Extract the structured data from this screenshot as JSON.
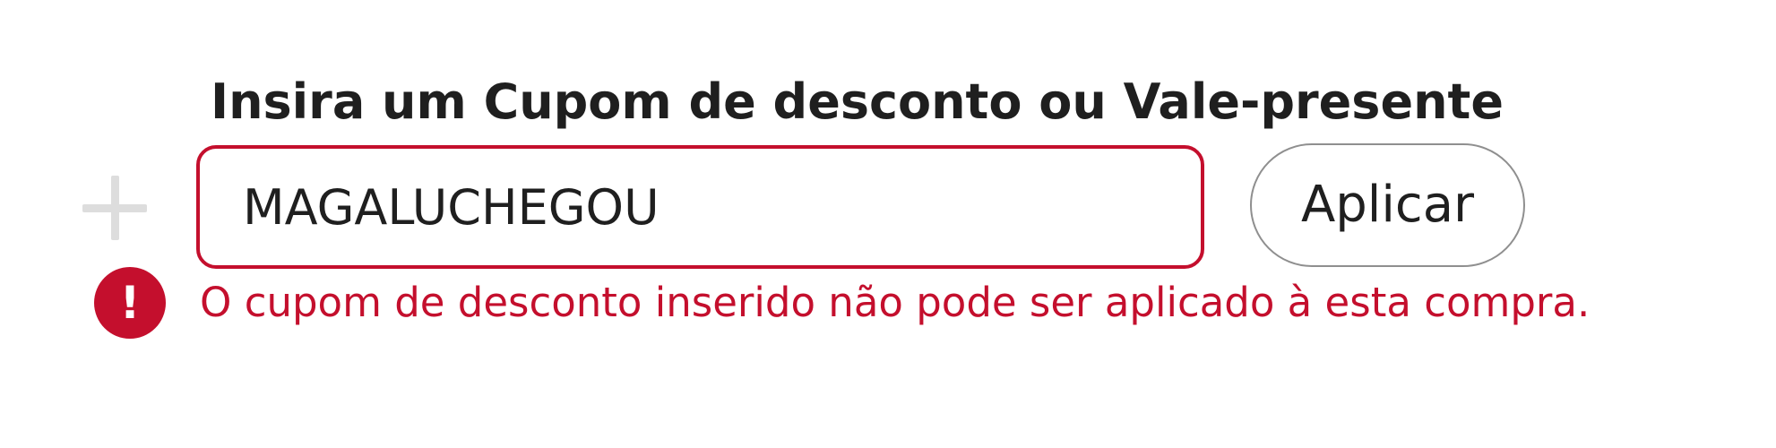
{
  "coupon_form": {
    "label": "Insira um Cupom de desconto ou Vale-presente",
    "expand_icon": "plus-icon",
    "input_value": "MAGALUCHEGOU",
    "apply_label": "Aplicar",
    "error_icon": "exclamation-icon",
    "error_icon_glyph": "!",
    "error_message": "O cupom de desconto inserido não pode ser aplicado à esta compra.",
    "colors": {
      "error": "#c40f2d",
      "text": "#1f1f1f",
      "expand_icon": "#dddddd",
      "button_border": "#8f8f8f"
    }
  }
}
